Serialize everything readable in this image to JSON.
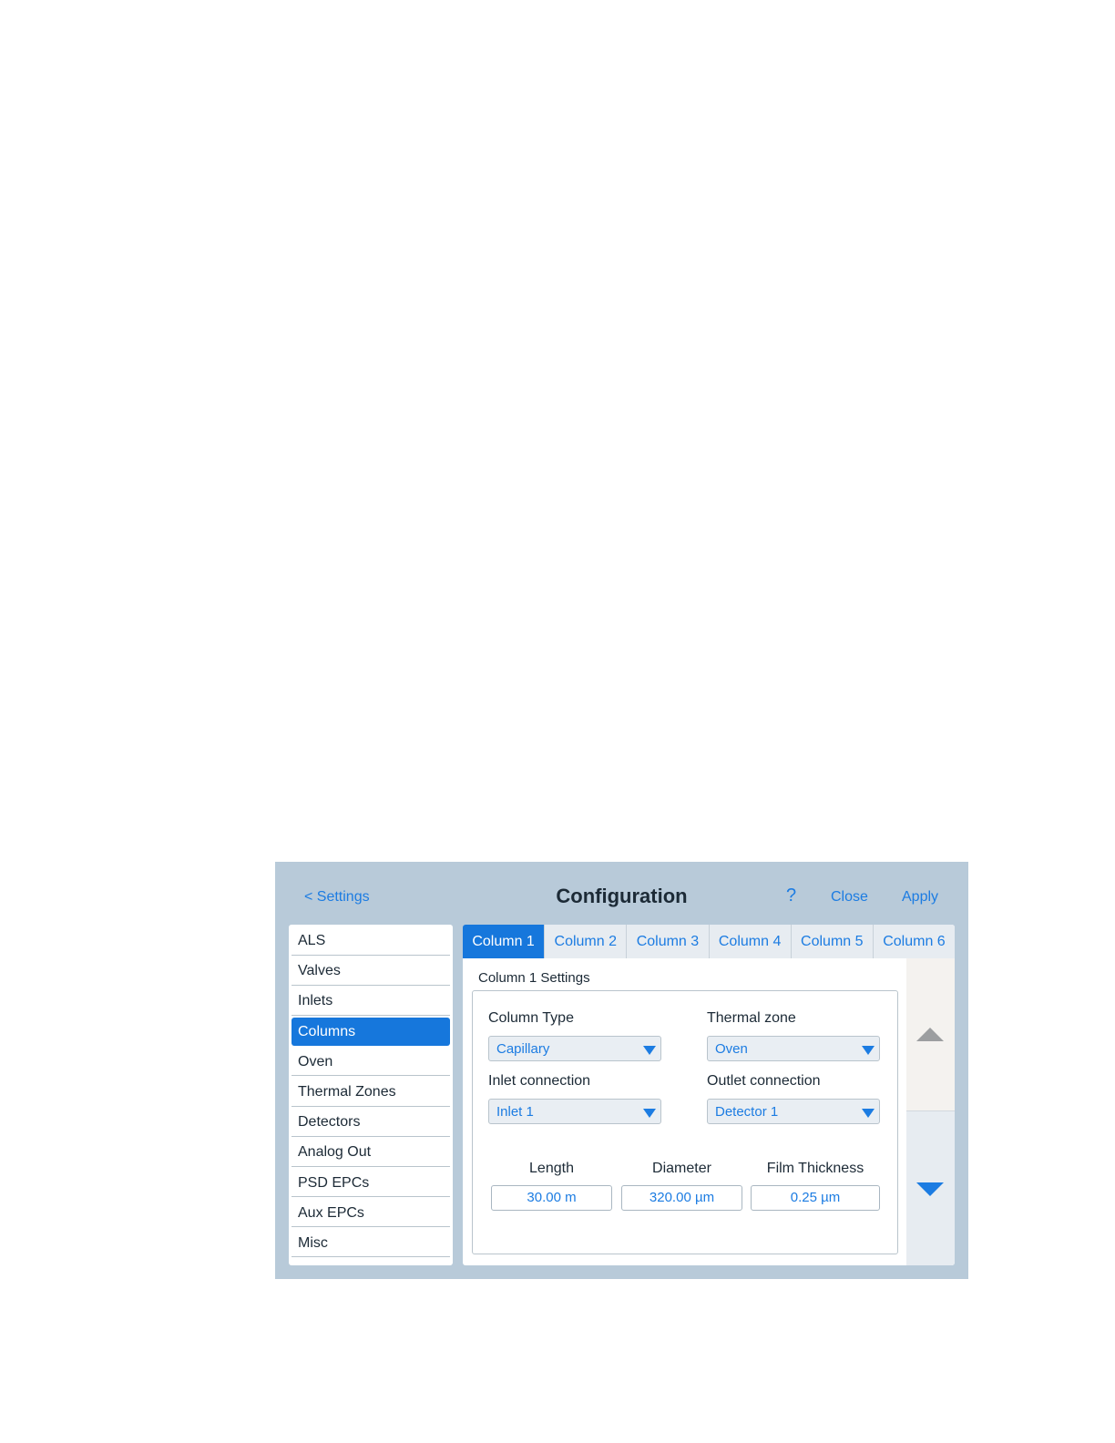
{
  "header": {
    "back_label": "< Settings",
    "title": "Configuration",
    "help_label": "?",
    "close_label": "Close",
    "apply_label": "Apply"
  },
  "sidebar": {
    "items": [
      {
        "label": "ALS"
      },
      {
        "label": "Valves"
      },
      {
        "label": "Inlets"
      },
      {
        "label": "Columns",
        "active": true
      },
      {
        "label": "Oven"
      },
      {
        "label": "Thermal Zones"
      },
      {
        "label": "Detectors"
      },
      {
        "label": "Analog Out"
      },
      {
        "label": "PSD EPCs"
      },
      {
        "label": "Aux EPCs"
      },
      {
        "label": "Misc"
      }
    ]
  },
  "tabs": [
    {
      "label": "Column 1",
      "active": true
    },
    {
      "label": "Column 2"
    },
    {
      "label": "Column 3"
    },
    {
      "label": "Column 4"
    },
    {
      "label": "Column 5"
    },
    {
      "label": "Column 6"
    }
  ],
  "settings": {
    "section_title": "Column 1 Settings",
    "column_type": {
      "label": "Column Type",
      "value": "Capillary"
    },
    "thermal_zone": {
      "label": "Thermal zone",
      "value": "Oven"
    },
    "inlet_connection": {
      "label": "Inlet connection",
      "value": "Inlet 1"
    },
    "outlet_connection": {
      "label": "Outlet connection",
      "value": "Detector 1"
    },
    "length": {
      "label": "Length",
      "value": "30.00 m"
    },
    "diameter": {
      "label": "Diameter",
      "value": "320.00 µm"
    },
    "film_thickness": {
      "label": "Film Thickness",
      "value": "0.25 µm"
    }
  },
  "colors": {
    "accent": "#1677dc",
    "link": "#1c7ce2",
    "panel_bg": "#b8cad9"
  },
  "icons": {
    "dropdown": "chevron-down-icon",
    "scroll_up": "triangle-up-icon",
    "scroll_down": "triangle-down-icon"
  }
}
